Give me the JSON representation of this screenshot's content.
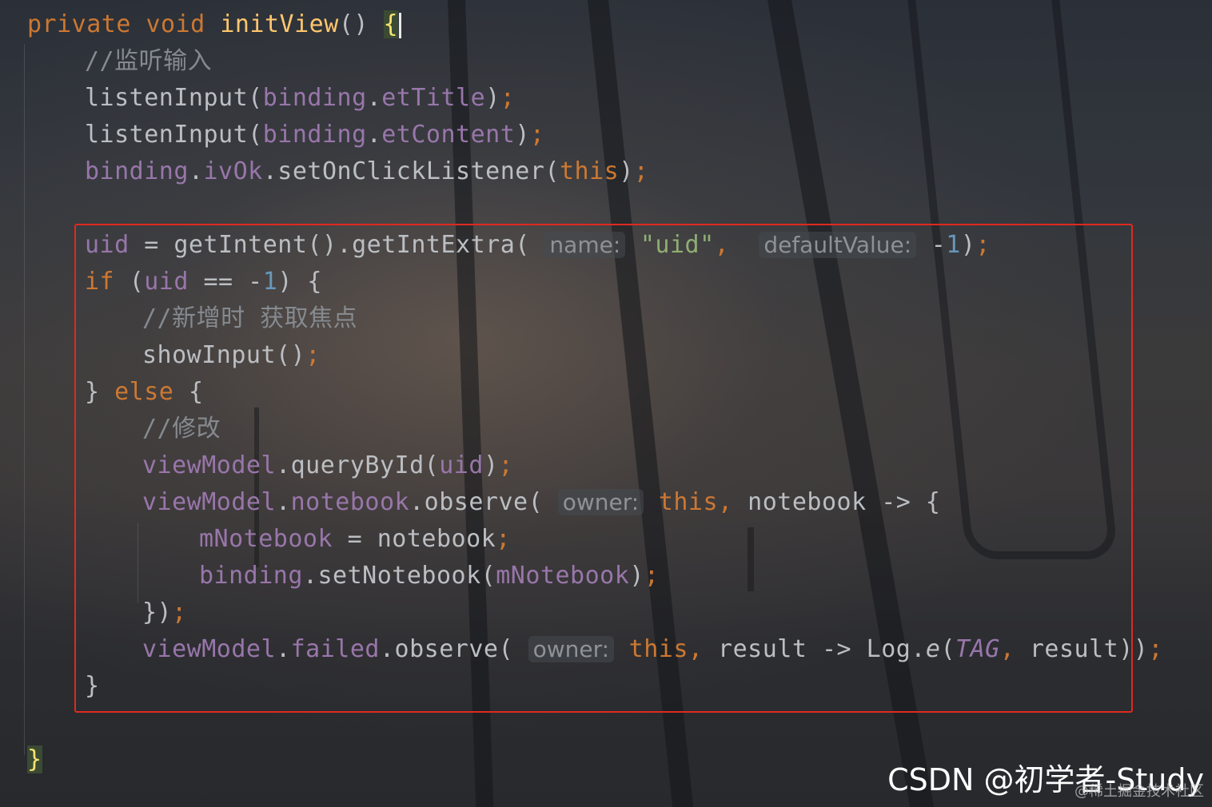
{
  "editor": {
    "lines": [
      [
        {
          "t": "private void ",
          "c": "kw"
        },
        {
          "t": "initView",
          "c": "fn"
        },
        {
          "t": "() ",
          "c": "plain"
        },
        {
          "t": "{",
          "c": "brace-hl"
        },
        {
          "cursor": true
        }
      ],
      [
        {
          "t": "//监听输入",
          "c": "cmt"
        }
      ],
      [
        {
          "t": "listenInput(",
          "c": "plain"
        },
        {
          "t": "binding",
          "c": "field"
        },
        {
          "t": ".",
          "c": "plain"
        },
        {
          "t": "etTitle",
          "c": "field"
        },
        {
          "t": ")",
          "c": "plain"
        },
        {
          "t": ";",
          "c": "kw"
        }
      ],
      [
        {
          "t": "listenInput(",
          "c": "plain"
        },
        {
          "t": "binding",
          "c": "field"
        },
        {
          "t": ".",
          "c": "plain"
        },
        {
          "t": "etContent",
          "c": "field"
        },
        {
          "t": ")",
          "c": "plain"
        },
        {
          "t": ";",
          "c": "kw"
        }
      ],
      [
        {
          "t": "binding",
          "c": "field"
        },
        {
          "t": ".",
          "c": "plain"
        },
        {
          "t": "ivOk",
          "c": "field"
        },
        {
          "t": ".setOnClickListener(",
          "c": "plain"
        },
        {
          "t": "this",
          "c": "kw"
        },
        {
          "t": ")",
          "c": "plain"
        },
        {
          "t": ";",
          "c": "kw"
        }
      ],
      [],
      [
        {
          "t": "uid",
          "c": "field"
        },
        {
          "t": " = getIntent().getIntExtra( ",
          "c": "plain"
        },
        {
          "t": "name:",
          "c": "hint"
        },
        {
          "t": " ",
          "c": "plain"
        },
        {
          "t": "\"uid\"",
          "c": "str"
        },
        {
          "t": ",  ",
          "c": "kw"
        },
        {
          "t": "defaultValue:",
          "c": "hint"
        },
        {
          "t": " -",
          "c": "plain"
        },
        {
          "t": "1",
          "c": "num"
        },
        {
          "t": ")",
          "c": "plain"
        },
        {
          "t": ";",
          "c": "kw"
        }
      ],
      [
        {
          "t": "if ",
          "c": "kw"
        },
        {
          "t": "(",
          "c": "plain"
        },
        {
          "t": "uid",
          "c": "field"
        },
        {
          "t": " == -",
          "c": "plain"
        },
        {
          "t": "1",
          "c": "num"
        },
        {
          "t": ") {",
          "c": "plain"
        }
      ],
      [
        {
          "t": "//新增时 获取焦点",
          "c": "cmt"
        }
      ],
      [
        {
          "t": "showInput()",
          "c": "plain"
        },
        {
          "t": ";",
          "c": "kw"
        }
      ],
      [
        {
          "t": "} ",
          "c": "plain"
        },
        {
          "t": "else ",
          "c": "kw"
        },
        {
          "t": "{",
          "c": "plain"
        }
      ],
      [
        {
          "t": "//修改",
          "c": "cmt"
        }
      ],
      [
        {
          "t": "viewModel",
          "c": "field"
        },
        {
          "t": ".queryById(",
          "c": "plain"
        },
        {
          "t": "uid",
          "c": "field"
        },
        {
          "t": ")",
          "c": "plain"
        },
        {
          "t": ";",
          "c": "kw"
        }
      ],
      [
        {
          "t": "viewModel",
          "c": "field"
        },
        {
          "t": ".",
          "c": "plain"
        },
        {
          "t": "notebook",
          "c": "field"
        },
        {
          "t": ".observe( ",
          "c": "plain"
        },
        {
          "t": "owner:",
          "c": "hint"
        },
        {
          "t": " ",
          "c": "plain"
        },
        {
          "t": "this",
          "c": "kw"
        },
        {
          "t": ", ",
          "c": "kw"
        },
        {
          "t": "notebook -> {",
          "c": "plain"
        }
      ],
      [
        {
          "t": "mNotebook",
          "c": "field"
        },
        {
          "t": " = notebook",
          "c": "plain"
        },
        {
          "t": ";",
          "c": "kw"
        }
      ],
      [
        {
          "t": "binding",
          "c": "field"
        },
        {
          "t": ".setNotebook(",
          "c": "plain"
        },
        {
          "t": "mNotebook",
          "c": "field"
        },
        {
          "t": ")",
          "c": "plain"
        },
        {
          "t": ";",
          "c": "kw"
        }
      ],
      [
        {
          "t": "})",
          "c": "plain"
        },
        {
          "t": ";",
          "c": "kw"
        }
      ],
      [
        {
          "t": "viewModel",
          "c": "field"
        },
        {
          "t": ".",
          "c": "plain"
        },
        {
          "t": "failed",
          "c": "field"
        },
        {
          "t": ".observe( ",
          "c": "plain"
        },
        {
          "t": "owner:",
          "c": "hint"
        },
        {
          "t": " ",
          "c": "plain"
        },
        {
          "t": "this",
          "c": "kw"
        },
        {
          "t": ", ",
          "c": "kw"
        },
        {
          "t": "result -> Log.",
          "c": "plain"
        },
        {
          "t": "e",
          "c": "plain it"
        },
        {
          "t": "(",
          "c": "plain"
        },
        {
          "t": "TAG",
          "c": "field it"
        },
        {
          "t": ", ",
          "c": "kw"
        },
        {
          "t": "result))",
          "c": "plain"
        },
        {
          "t": ";",
          "c": "kw"
        }
      ],
      [
        {
          "t": "}",
          "c": "plain"
        }
      ],
      [],
      [
        {
          "t": "}",
          "c": "brace-hl"
        }
      ]
    ]
  },
  "colors": {
    "keyword": "#cc7832",
    "method_decl": "#ffc66d",
    "field": "#9876aa",
    "comment": "#858a8f",
    "number": "#6897bb",
    "string": "#8fae73",
    "highlight_box": "#e0291f"
  },
  "watermark": {
    "main": "CSDN @初学者-Study",
    "sub": "@稀土掘金技术社区"
  }
}
